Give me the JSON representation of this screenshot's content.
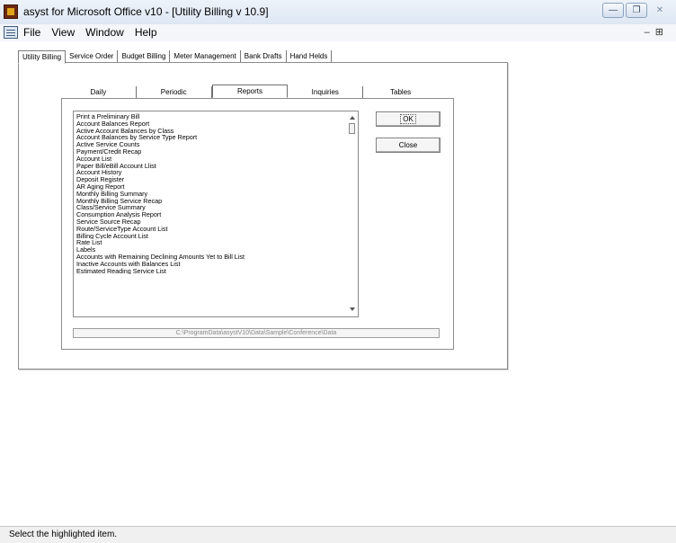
{
  "window": {
    "title": "asyst for Microsoft Office v10 - [Utility Billing  v 10.9]"
  },
  "menu": {
    "items": [
      "File",
      "View",
      "Window",
      "Help"
    ]
  },
  "top_tabs": [
    "Utility Billing",
    "Service Order",
    "Budget Billing",
    "Meter Management",
    "Bank Drafts",
    "Hand Helds"
  ],
  "inner_tabs": [
    "Daily",
    "Periodic",
    "Reports",
    "Inquiries",
    "Tables"
  ],
  "reports": [
    "Print a Preliminary Bill",
    "Account Balances Report",
    "Active Account Balances by Class",
    "Account Balances by Service Type Report",
    "Active Service Counts",
    "Payment/Credit Recap",
    "Account List",
    "Paper Bill/eBill Account Llist",
    "Account History",
    "Deposit Register",
    "AR Aging Report",
    "Monthly Billing Summary",
    "Monthly Billing Service Recap",
    "Class/Service Summary",
    "Consumption Analysis Report",
    "Service Source Recap",
    "Route/ServiceType Account List",
    "Billing Cycle Account List",
    "Rate List",
    "Labels",
    "Accounts with Remaining Declining Amounts Yet to Bill List",
    "Inactive Accounts with Balances List",
    "Estimated Reading Service List"
  ],
  "buttons": {
    "ok": "OK",
    "close": "Close"
  },
  "data_path": "C:\\ProgramData\\asystV10\\Data\\Sample\\Conference\\Data",
  "status": "Select the highlighted item."
}
